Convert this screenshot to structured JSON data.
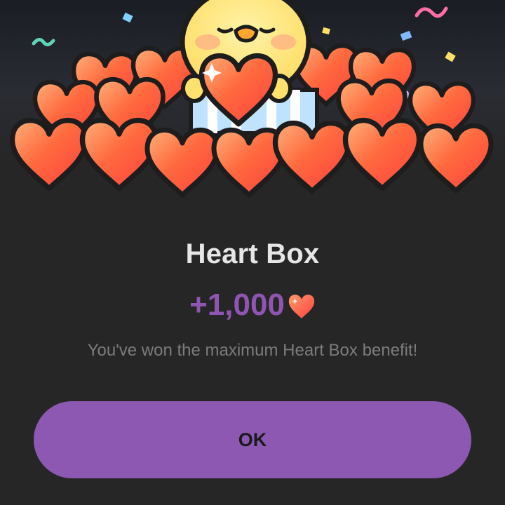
{
  "dialog": {
    "title": "Heart Box",
    "reward_amount": "+1,000",
    "reward_icon": "heart-icon",
    "message": "You've won the maximum Heart Box benefit!",
    "ok_label": "OK"
  },
  "illustration": {
    "subject": "chick-holding-heart-icon",
    "heart_color": "#ff5a3c",
    "chick_color": "#ffe47a"
  },
  "colors": {
    "accent": "#8d58b1",
    "reward_text": "#8f55b3",
    "background": "#262626"
  }
}
